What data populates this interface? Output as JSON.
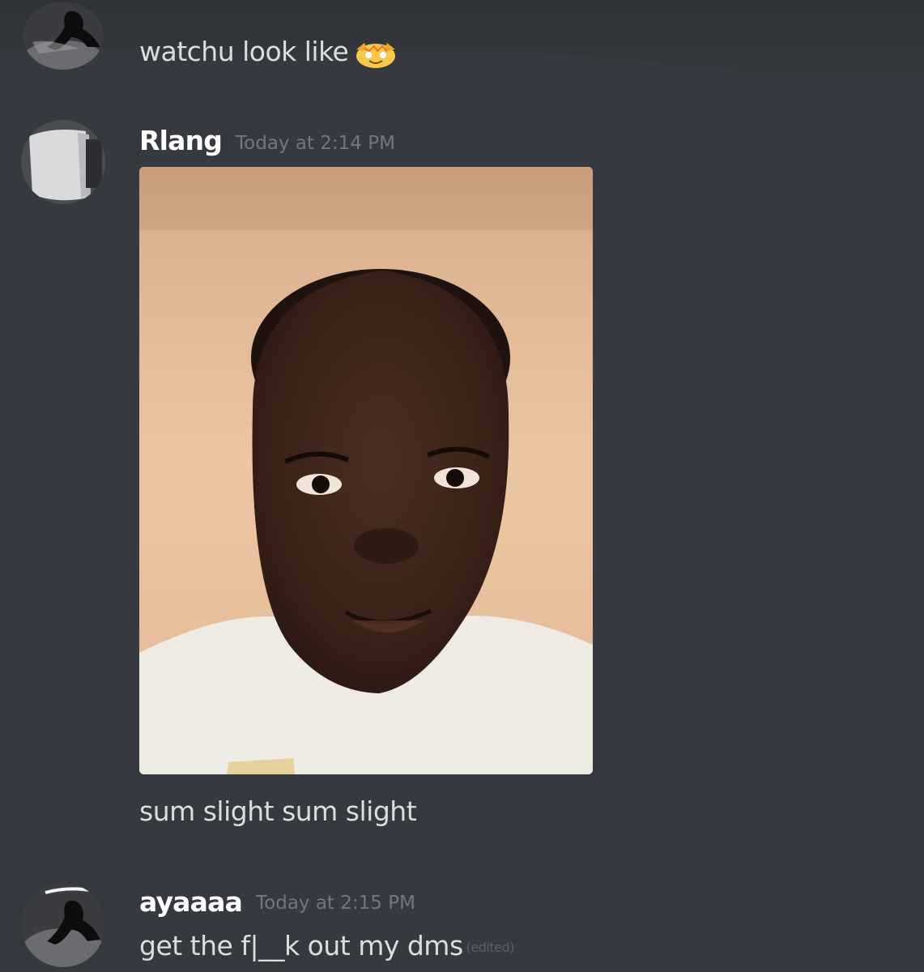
{
  "messages": [
    {
      "id": "msg-1",
      "text": "watchu look like",
      "emoji": "star-struck-face-emoji"
    },
    {
      "id": "msg-2",
      "username": "Rlang",
      "timestamp": "Today at 2:14 PM",
      "caption": "sum slight sum slight"
    },
    {
      "id": "msg-3",
      "username": "ayaaaa",
      "timestamp": "Today at 2:15 PM",
      "text": "get the f|__k out my dms",
      "edited_label": "(edited)"
    }
  ],
  "colors": {
    "background": "#36393f",
    "username": "#ffffff",
    "message_text": "#dcddde",
    "timestamp": "#72767d"
  }
}
